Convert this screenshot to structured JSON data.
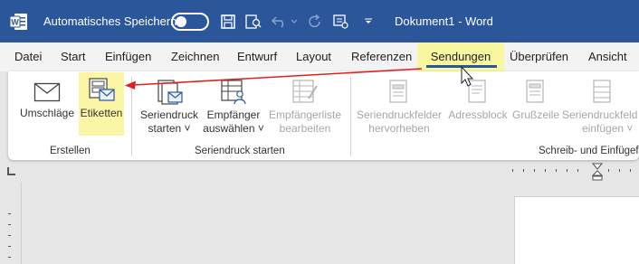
{
  "titlebar": {
    "autosave_label": "Automatisches Speichern",
    "document_title": "Dokument1  -  Word",
    "word_logo_letter": "W"
  },
  "tabs": [
    "Datei",
    "Start",
    "Einfügen",
    "Zeichnen",
    "Entwurf",
    "Layout",
    "Referenzen",
    "Sendungen",
    "Überprüfen",
    "Ansicht"
  ],
  "active_tab": "Sendungen",
  "ribbon": {
    "erstellen": {
      "umschlaege": "Umschläge",
      "etiketten": "Etiketten",
      "group_label": "Erstellen"
    },
    "seriendruck_starten": {
      "seriendruck_l1": "Seriendruck",
      "seriendruck_l2": "starten ˅",
      "empfaenger_l1": "Empfänger",
      "empfaenger_l2": "auswählen ˅",
      "empfaengerliste_l1": "Empfängerliste",
      "empfaengerliste_l2": "bearbeiten",
      "group_label": "Seriendruck starten"
    },
    "schreiben": {
      "seriendruckfelder_l1": "Seriendruckfelder",
      "seriendruckfelder_l2": "hervorheben",
      "adressblock": "Adressblock",
      "grusszeile": "Grußzeile",
      "einfuegen_l1": "Seriendruckfeld",
      "einfuegen_l2": "einfügen ˅",
      "group_label": "Schreib- und Einfügef"
    }
  },
  "colors": {
    "accent_blue": "#2b579a",
    "highlight_yellow": "#fbf6a5",
    "arrow_red": "#e0201b"
  }
}
